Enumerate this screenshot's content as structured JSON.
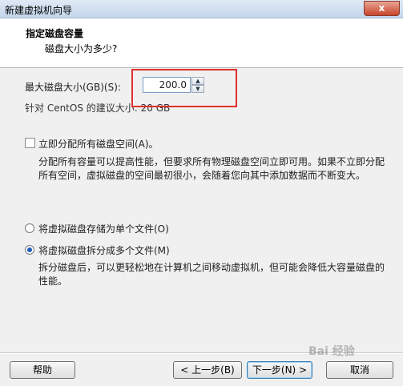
{
  "window": {
    "title": "新建虚拟机向导",
    "close_glyph": "x"
  },
  "header": {
    "title": "指定磁盘容量",
    "subtitle": "磁盘大小为多少?"
  },
  "disk_size": {
    "label": "最大磁盘大小(GB)(S):",
    "value": "200.0",
    "recommended": "针对 CentOS 的建议大小: 20 GB",
    "up_glyph": "▲",
    "down_glyph": "▼"
  },
  "allocate": {
    "label": "立即分配所有磁盘空间(A)。",
    "checked": false,
    "desc_line1": "分配所有容量可以提高性能，但要求所有物理磁盘空间立即可用。如果不立即分配",
    "desc_line2": "所有空间，虚拟磁盘的空间最初很小，会随着您向其中添加数据而不断变大。"
  },
  "storage_options": [
    {
      "label": "将虚拟磁盘存储为单个文件(O)",
      "checked": false
    },
    {
      "label": "将虚拟磁盘拆分成多个文件(M)",
      "checked": true
    }
  ],
  "split_desc": {
    "line1": "拆分磁盘后，可以更轻松地在计算机之间移动虚拟机，但可能会降低大容量磁盘的",
    "line2": "性能。"
  },
  "buttons": {
    "help": "帮助",
    "back": "< 上一步(B)",
    "next": "下一步(N) >",
    "cancel": "取消"
  },
  "watermark": "Bai 经验"
}
